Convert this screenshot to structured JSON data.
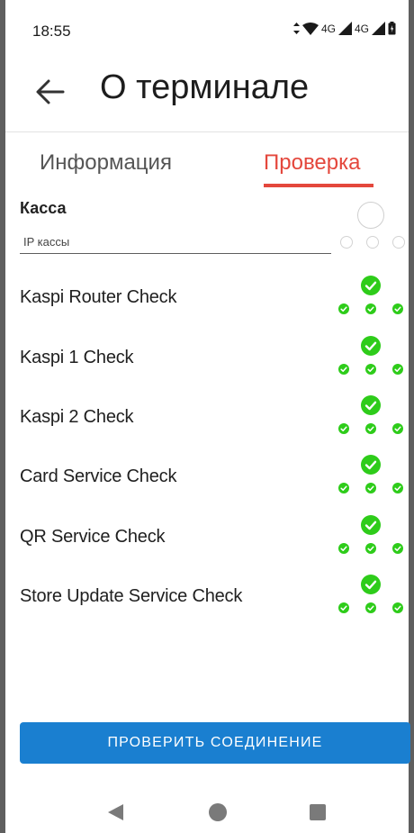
{
  "status_bar": {
    "time": "18:55",
    "net1": "4G",
    "net2": "4G"
  },
  "header": {
    "title": "О терминале",
    "back_icon": "arrow-left-icon"
  },
  "tabs": [
    {
      "label": "Информация",
      "active": false
    },
    {
      "label": "Проверка",
      "active": true
    }
  ],
  "kassa": {
    "label": "Касса",
    "placeholder": "IP кассы",
    "value": ""
  },
  "checks": [
    {
      "label": "Kaspi Router Check"
    },
    {
      "label": "Kaspi 1 Check"
    },
    {
      "label": "Kaspi 2 Check"
    },
    {
      "label": "Card Service Check"
    },
    {
      "label": "QR Service Check"
    },
    {
      "label": "Store Update Service Check"
    }
  ],
  "action": {
    "label": "ПРОВЕРИТЬ СОЕДИНЕНИЕ"
  },
  "colors": {
    "accent": "#e4473c",
    "primary": "#1a7fd0",
    "success": "#2ecc1a"
  },
  "nav": {
    "back": "triangle-back-icon",
    "home": "circle-home-icon",
    "recents": "square-recents-icon"
  }
}
